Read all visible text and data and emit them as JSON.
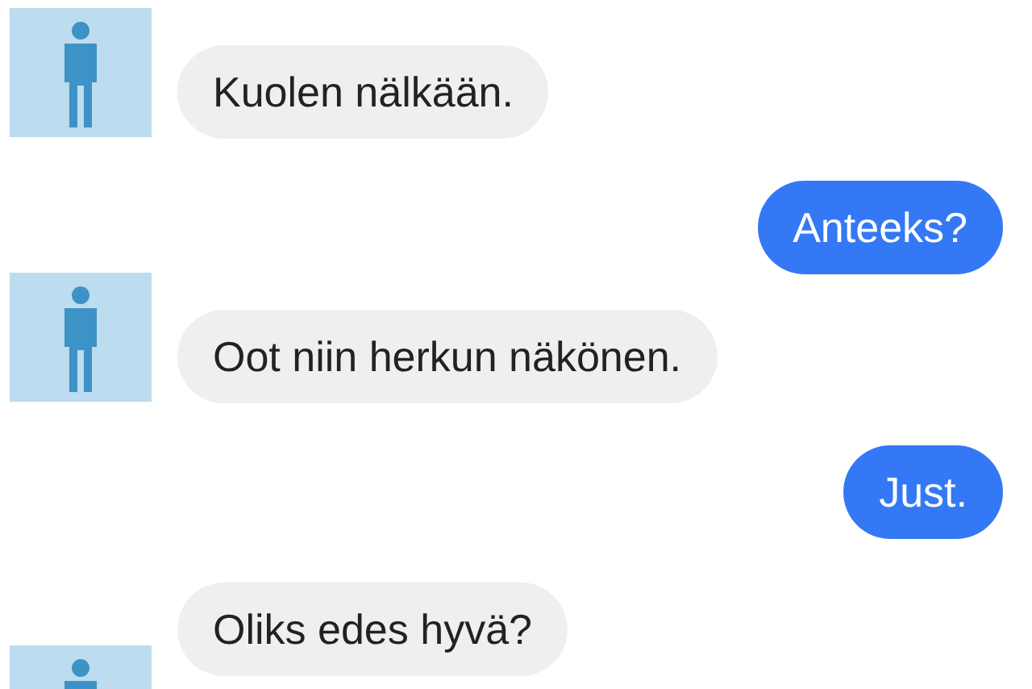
{
  "messages": [
    {
      "kind": "incoming",
      "text": "Kuolen nälkään."
    },
    {
      "kind": "outgoing",
      "text": "Anteeks?"
    },
    {
      "kind": "incoming",
      "text": "Oot niin herkun näkönen."
    },
    {
      "kind": "outgoing",
      "text": "Just."
    },
    {
      "kind": "incoming-cont",
      "text": "Oliks edes hyvä?"
    },
    {
      "kind": "avatar"
    }
  ]
}
